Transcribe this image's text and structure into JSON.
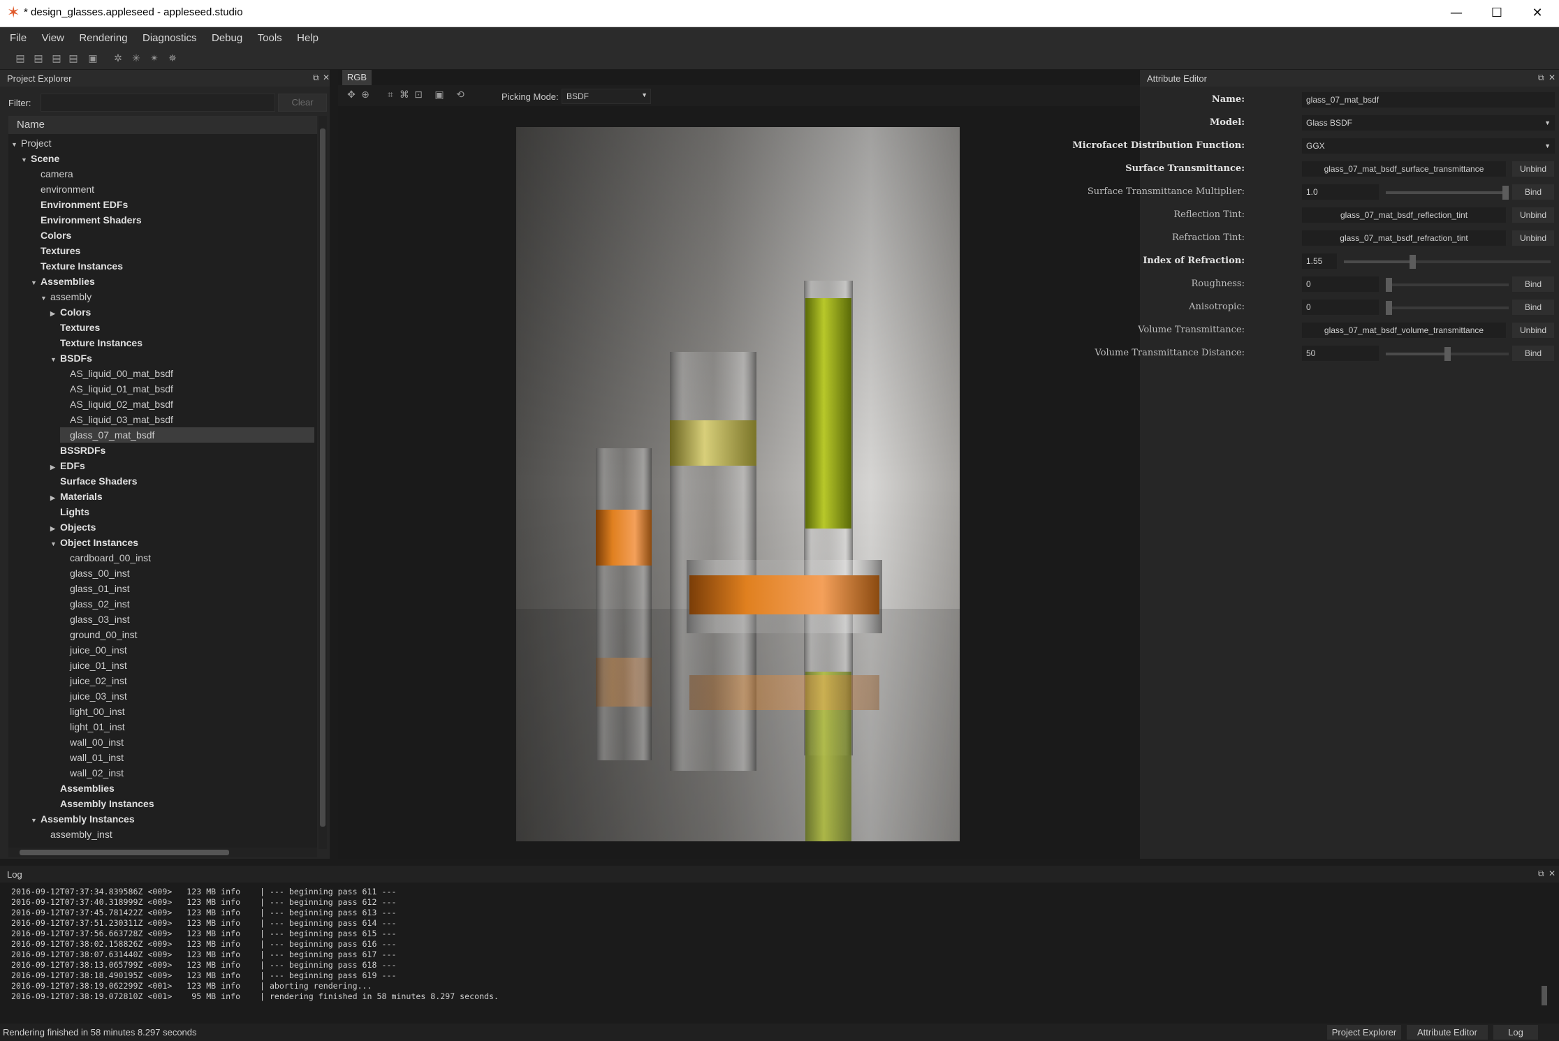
{
  "window": {
    "title": "* design_glasses.appleseed - appleseed.studio",
    "minimize": "—",
    "maximize": "☐",
    "close": "✕"
  },
  "menu": [
    "File",
    "View",
    "Rendering",
    "Diagnostics",
    "Debug",
    "Tools",
    "Help"
  ],
  "project_explorer": {
    "title": "Project Explorer",
    "filter_label": "Filter:",
    "filter_value": "",
    "clear_label": "Clear",
    "column_header": "Name",
    "tree": [
      {
        "label": "Project",
        "depth": 0,
        "arrow": "open",
        "bold": false
      },
      {
        "label": "Scene",
        "depth": 1,
        "arrow": "open",
        "bold": true
      },
      {
        "label": "camera",
        "depth": 2,
        "arrow": "",
        "bold": false
      },
      {
        "label": "environment",
        "depth": 2,
        "arrow": "",
        "bold": false
      },
      {
        "label": "Environment EDFs",
        "depth": 2,
        "arrow": "",
        "bold": true
      },
      {
        "label": "Environment Shaders",
        "depth": 2,
        "arrow": "",
        "bold": true
      },
      {
        "label": "Colors",
        "depth": 2,
        "arrow": "",
        "bold": true
      },
      {
        "label": "Textures",
        "depth": 2,
        "arrow": "",
        "bold": true
      },
      {
        "label": "Texture Instances",
        "depth": 2,
        "arrow": "",
        "bold": true
      },
      {
        "label": "Assemblies",
        "depth": 2,
        "arrow": "open",
        "bold": true
      },
      {
        "label": "assembly",
        "depth": 3,
        "arrow": "open",
        "bold": false
      },
      {
        "label": "Colors",
        "depth": 4,
        "arrow": "closed",
        "bold": true
      },
      {
        "label": "Textures",
        "depth": 4,
        "arrow": "",
        "bold": true
      },
      {
        "label": "Texture Instances",
        "depth": 4,
        "arrow": "",
        "bold": true
      },
      {
        "label": "BSDFs",
        "depth": 4,
        "arrow": "open",
        "bold": true
      },
      {
        "label": "AS_liquid_00_mat_bsdf",
        "depth": 5,
        "arrow": "",
        "bold": false
      },
      {
        "label": "AS_liquid_01_mat_bsdf",
        "depth": 5,
        "arrow": "",
        "bold": false
      },
      {
        "label": "AS_liquid_02_mat_bsdf",
        "depth": 5,
        "arrow": "",
        "bold": false
      },
      {
        "label": "AS_liquid_03_mat_bsdf",
        "depth": 5,
        "arrow": "",
        "bold": false
      },
      {
        "label": "glass_07_mat_bsdf",
        "depth": 5,
        "arrow": "",
        "bold": false,
        "selected": true
      },
      {
        "label": "BSSRDFs",
        "depth": 4,
        "arrow": "",
        "bold": true
      },
      {
        "label": "EDFs",
        "depth": 4,
        "arrow": "closed",
        "bold": true
      },
      {
        "label": "Surface Shaders",
        "depth": 4,
        "arrow": "",
        "bold": true
      },
      {
        "label": "Materials",
        "depth": 4,
        "arrow": "closed",
        "bold": true
      },
      {
        "label": "Lights",
        "depth": 4,
        "arrow": "",
        "bold": true
      },
      {
        "label": "Objects",
        "depth": 4,
        "arrow": "closed",
        "bold": true
      },
      {
        "label": "Object Instances",
        "depth": 4,
        "arrow": "open",
        "bold": true
      },
      {
        "label": "cardboard_00_inst",
        "depth": 5,
        "arrow": "",
        "bold": false
      },
      {
        "label": "glass_00_inst",
        "depth": 5,
        "arrow": "",
        "bold": false
      },
      {
        "label": "glass_01_inst",
        "depth": 5,
        "arrow": "",
        "bold": false
      },
      {
        "label": "glass_02_inst",
        "depth": 5,
        "arrow": "",
        "bold": false
      },
      {
        "label": "glass_03_inst",
        "depth": 5,
        "arrow": "",
        "bold": false
      },
      {
        "label": "ground_00_inst",
        "depth": 5,
        "arrow": "",
        "bold": false
      },
      {
        "label": "juice_00_inst",
        "depth": 5,
        "arrow": "",
        "bold": false
      },
      {
        "label": "juice_01_inst",
        "depth": 5,
        "arrow": "",
        "bold": false
      },
      {
        "label": "juice_02_inst",
        "depth": 5,
        "arrow": "",
        "bold": false
      },
      {
        "label": "juice_03_inst",
        "depth": 5,
        "arrow": "",
        "bold": false
      },
      {
        "label": "light_00_inst",
        "depth": 5,
        "arrow": "",
        "bold": false
      },
      {
        "label": "light_01_inst",
        "depth": 5,
        "arrow": "",
        "bold": false
      },
      {
        "label": "wall_00_inst",
        "depth": 5,
        "arrow": "",
        "bold": false
      },
      {
        "label": "wall_01_inst",
        "depth": 5,
        "arrow": "",
        "bold": false
      },
      {
        "label": "wall_02_inst",
        "depth": 5,
        "arrow": "",
        "bold": false
      },
      {
        "label": "Assemblies",
        "depth": 4,
        "arrow": "",
        "bold": true
      },
      {
        "label": "Assembly Instances",
        "depth": 4,
        "arrow": "",
        "bold": true
      },
      {
        "label": "Assembly Instances",
        "depth": 2,
        "arrow": "open",
        "bold": true
      },
      {
        "label": "assembly_inst",
        "depth": 3,
        "arrow": "",
        "bold": false
      }
    ]
  },
  "render": {
    "tab": "RGB",
    "picking_mode_label": "Picking Mode:",
    "picking_mode_value": "BSDF"
  },
  "attribute_editor": {
    "title": "Attribute Editor",
    "rows": [
      {
        "label": "Name:",
        "bold": true,
        "value": "glass_07_mat_bsdf",
        "kind": "text"
      },
      {
        "label": "Model:",
        "bold": true,
        "value": "Glass BSDF",
        "kind": "combo"
      },
      {
        "label": "Microfacet Distribution Function:",
        "bold": true,
        "value": "GGX",
        "kind": "combo"
      },
      {
        "label": "Surface Transmittance:",
        "bold": true,
        "value": "glass_07_mat_bsdf_surface_transmittance",
        "kind": "bound",
        "button": "Unbind"
      },
      {
        "label": "Surface Transmittance Multiplier:",
        "bold": false,
        "value": "1.0",
        "kind": "slider",
        "level": 1.0,
        "button": "Bind"
      },
      {
        "label": "Reflection Tint:",
        "bold": false,
        "value": "glass_07_mat_bsdf_reflection_tint",
        "kind": "bound",
        "button": "Unbind"
      },
      {
        "label": "Refraction Tint:",
        "bold": false,
        "value": "glass_07_mat_bsdf_refraction_tint",
        "kind": "bound",
        "button": "Unbind"
      },
      {
        "label": "Index of Refraction:",
        "bold": true,
        "value": "1.55",
        "kind": "slider-wide",
        "level": 0.33,
        "button": ""
      },
      {
        "label": "Roughness:",
        "bold": false,
        "value": "0",
        "kind": "slider",
        "level": 0.0,
        "button": "Bind"
      },
      {
        "label": "Anisotropic:",
        "bold": false,
        "value": "0",
        "kind": "slider",
        "level": 0.0,
        "button": "Bind"
      },
      {
        "label": "Volume Transmittance:",
        "bold": false,
        "value": "glass_07_mat_bsdf_volume_transmittance",
        "kind": "bound",
        "button": "Unbind"
      },
      {
        "label": "Volume Transmittance Distance:",
        "bold": false,
        "value": "50",
        "kind": "slider",
        "level": 0.5,
        "button": "Bind"
      }
    ]
  },
  "log": {
    "title": "Log",
    "lines": [
      "2016-09-12T07:37:34.839586Z <009>   123 MB info    | --- beginning pass 611 ---",
      "2016-09-12T07:37:40.318999Z <009>   123 MB info    | --- beginning pass 612 ---",
      "2016-09-12T07:37:45.781422Z <009>   123 MB info    | --- beginning pass 613 ---",
      "2016-09-12T07:37:51.230311Z <009>   123 MB info    | --- beginning pass 614 ---",
      "2016-09-12T07:37:56.663728Z <009>   123 MB info    | --- beginning pass 615 ---",
      "2016-09-12T07:38:02.158826Z <009>   123 MB info    | --- beginning pass 616 ---",
      "2016-09-12T07:38:07.631440Z <009>   123 MB info    | --- beginning pass 617 ---",
      "2016-09-12T07:38:13.065799Z <009>   123 MB info    | --- beginning pass 618 ---",
      "2016-09-12T07:38:18.490195Z <009>   123 MB info    | --- beginning pass 619 ---",
      "2016-09-12T07:38:19.062299Z <001>   123 MB info    | aborting rendering...",
      "2016-09-12T07:38:19.072810Z <001>    95 MB info    | rendering finished in 58 minutes 8.297 seconds."
    ]
  },
  "status": {
    "text": "Rendering finished in 58 minutes 8.297 seconds",
    "buttons": [
      "Project Explorer",
      "Attribute Editor",
      "Log"
    ]
  },
  "icons": {
    "app": "appleseed-logo-icon",
    "toolbar": [
      "new-project-icon",
      "open-project-icon",
      "open-recent-icon",
      "reload-icon",
      "save-icon",
      "render-start-icon",
      "render-stop-icon",
      "render-settings-icon",
      "render-pause-icon"
    ],
    "render_toolbar": [
      "pan-icon",
      "zoom-icon",
      "frame-icon",
      "fit-icon",
      "clear-frame-icon",
      "camera-icon",
      "reset-icon"
    ]
  }
}
